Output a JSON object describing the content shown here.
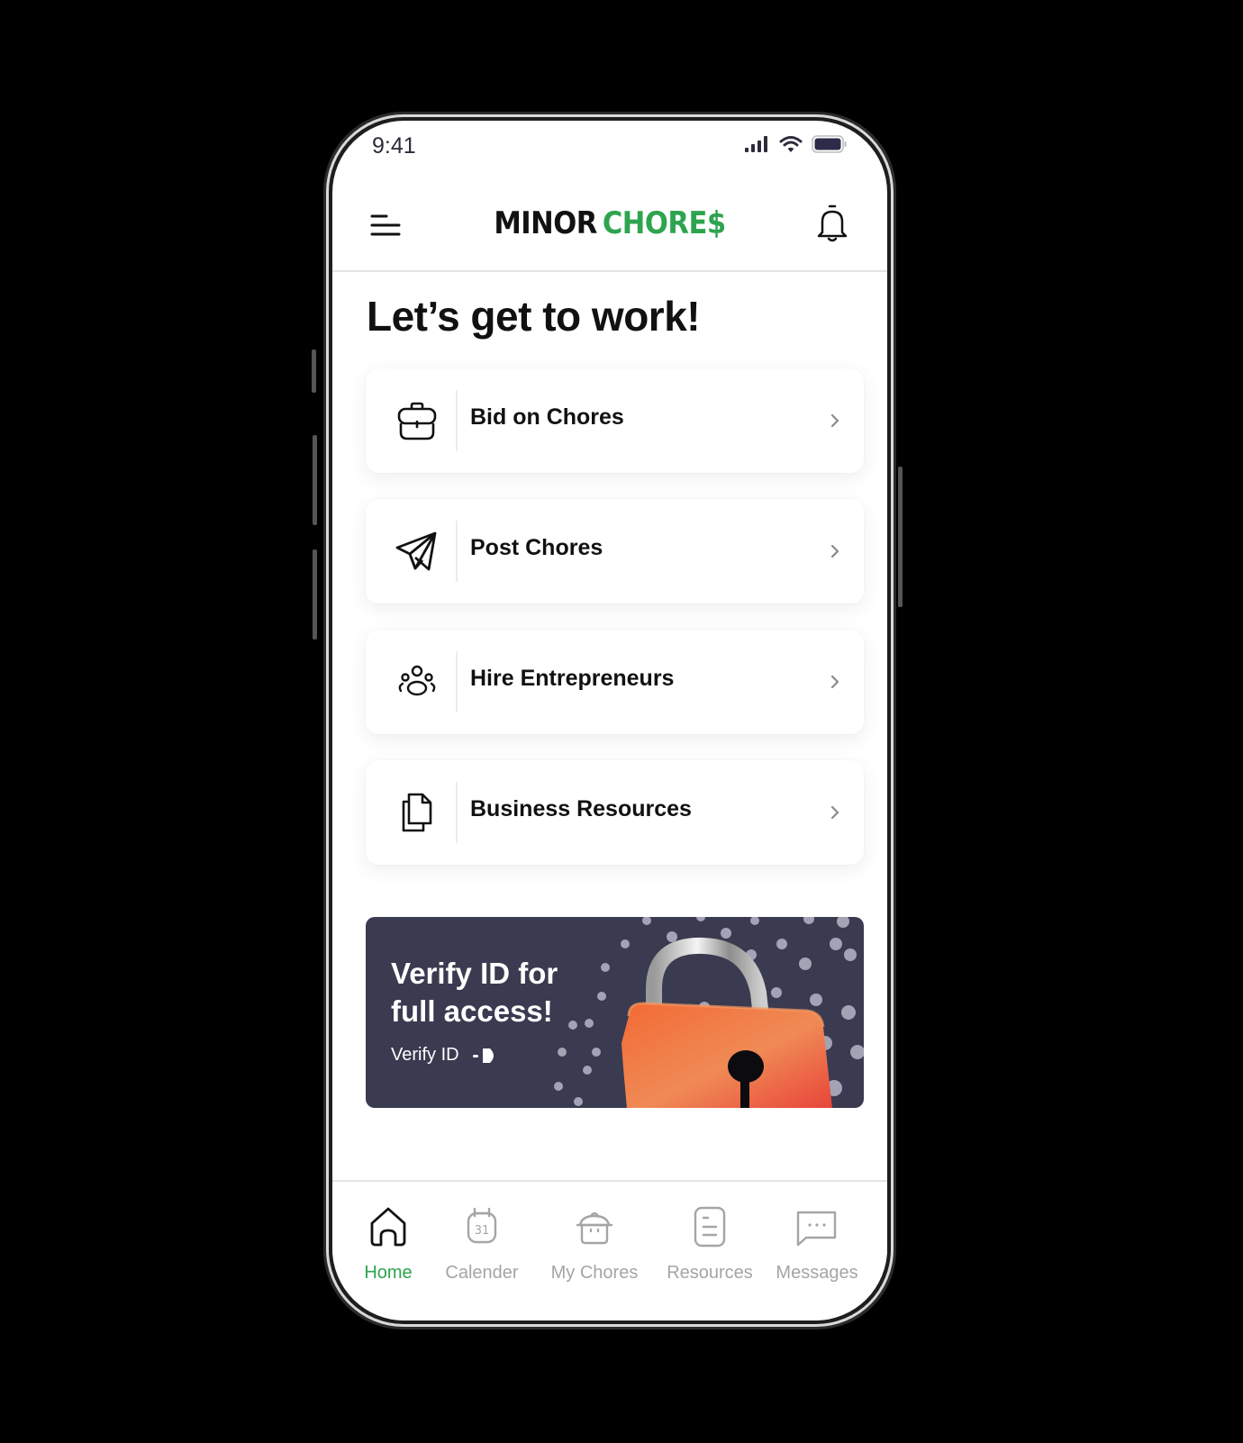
{
  "status_bar": {
    "time": "9:41"
  },
  "header": {
    "logo_part1": "MINOR",
    "logo_part2": "CHORE$",
    "brand_color": "#2ea44f"
  },
  "main": {
    "title": "Let’s get to work!",
    "cards": [
      {
        "label": "Bid on Chores",
        "icon": "briefcase-icon"
      },
      {
        "label": "Post Chores",
        "icon": "paper-plane-icon"
      },
      {
        "label": "Hire Entrepreneurs",
        "icon": "people-group-icon"
      },
      {
        "label": "Business Resources",
        "icon": "documents-icon"
      }
    ],
    "banner": {
      "title": "Verify ID for full access!",
      "link_label": "Verify ID",
      "background_color": "#3a3a50",
      "image": "padlock-illustration"
    }
  },
  "bottom_nav": {
    "active_index": 0,
    "items": [
      {
        "label": "Home",
        "icon": "home-icon"
      },
      {
        "label": "Calender",
        "icon": "calendar-icon"
      },
      {
        "label": "My Chores",
        "icon": "chores-pot-icon"
      },
      {
        "label": "Resources",
        "icon": "resources-document-icon"
      },
      {
        "label": "Messages",
        "icon": "message-icon"
      }
    ]
  }
}
